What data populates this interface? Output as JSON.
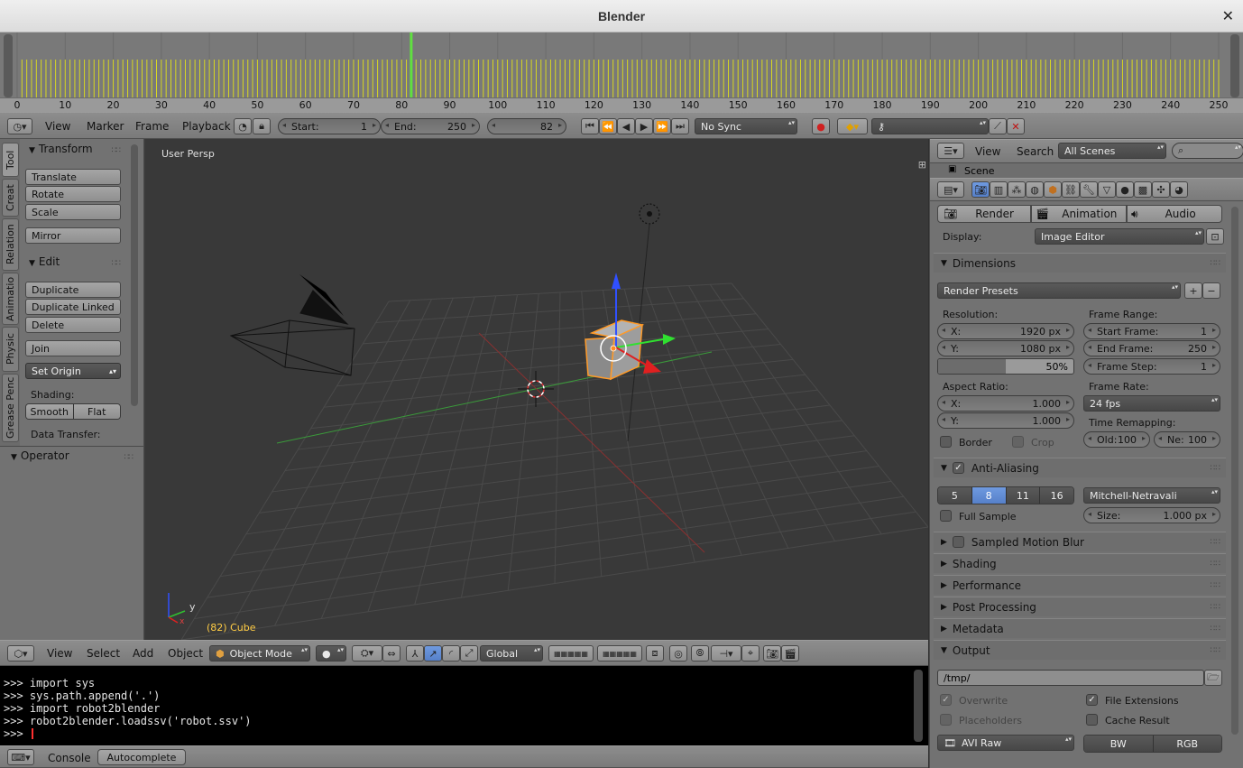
{
  "window": {
    "title": "Blender",
    "close_glyph": "✕"
  },
  "timeline": {
    "ruler_labels": [
      "0",
      "10",
      "20",
      "30",
      "40",
      "50",
      "60",
      "70",
      "80",
      "90",
      "100",
      "110",
      "120",
      "130",
      "140",
      "150",
      "160",
      "170",
      "180",
      "190",
      "200",
      "210",
      "220",
      "230",
      "240",
      "250"
    ],
    "current_frame_marker": 82,
    "keyframe_color": "#d8d820",
    "current_color": "#60e040"
  },
  "timeline_header": {
    "menus": [
      "View",
      "Marker",
      "Frame",
      "Playback"
    ],
    "start_label": "Start:",
    "start_value": "1",
    "end_label": "End:",
    "end_value": "250",
    "current_value": "82",
    "sync": "No Sync"
  },
  "toolshelf": {
    "tabs": [
      "Tool",
      "Creat",
      "Relation",
      "Animatio",
      "Physic",
      "Grease Penc"
    ],
    "transform": {
      "title": "Transform",
      "buttons": [
        "Translate",
        "Rotate",
        "Scale",
        "Mirror"
      ]
    },
    "edit": {
      "title": "Edit",
      "buttons": [
        "Duplicate",
        "Duplicate Linked",
        "Delete",
        "Join"
      ],
      "set_origin": "Set Origin"
    },
    "shading_label": "Shading:",
    "smooth": "Smooth",
    "flat": "Flat",
    "data_transfer_label": "Data Transfer:",
    "operator_title": "Operator"
  },
  "viewport": {
    "title": "User Persp",
    "object_label": "(82) Cube",
    "axis_y": "y",
    "axis_x": "x"
  },
  "view3d_header": {
    "menus": [
      "View",
      "Select",
      "Add",
      "Object"
    ],
    "mode": "Object Mode",
    "orientation": "Global"
  },
  "console": {
    "lines": [
      ">>> import sys",
      ">>> sys.path.append('.')",
      ">>> import robot2blender",
      ">>> robot2blender.loadssv('robot.ssv')",
      ">>> "
    ],
    "tabs": [
      "Console",
      "Autocomplete"
    ]
  },
  "outliner_header": {
    "menus": [
      "View",
      "Search"
    ],
    "scenes": "All Scenes",
    "scene_item": "Scene"
  },
  "properties": {
    "tabs": [
      "Render",
      "Animation",
      "Audio"
    ],
    "display_label": "Display:",
    "display_value": "Image Editor",
    "dimensions": {
      "title": "Dimensions",
      "presets": "Render Presets",
      "resolution_label": "Resolution:",
      "res_x_label": "X:",
      "res_x": "1920 px",
      "res_y_label": "Y:",
      "res_y": "1080 px",
      "res_pct": "50%",
      "frame_range_label": "Frame Range:",
      "start_frame_label": "Start Frame:",
      "start_frame": "1",
      "end_frame_label": "End Frame:",
      "end_frame": "250",
      "frame_step_label": "Frame Step:",
      "frame_step": "1",
      "aspect_label": "Aspect Ratio:",
      "asp_x_label": "X:",
      "asp_x": "1.000",
      "asp_y_label": "Y:",
      "asp_y": "1.000",
      "frame_rate_label": "Frame Rate:",
      "frame_rate": "24 fps",
      "time_remap_label": "Time Remapping:",
      "old_label": "Old:",
      "old_value": "100",
      "new_label": "Ne:",
      "new_value": "100",
      "border": "Border",
      "crop": "Crop"
    },
    "aa": {
      "title": "Anti-Aliasing",
      "samples": [
        "5",
        "8",
        "11",
        "16"
      ],
      "selected": "8",
      "filter": "Mitchell-Netravali",
      "full_sample": "Full Sample",
      "size_label": "Size:",
      "size_value": "1.000 px"
    },
    "collapsed_sections": [
      "Sampled Motion Blur",
      "Shading",
      "Performance",
      "Post Processing",
      "Metadata"
    ],
    "output": {
      "title": "Output",
      "path": "/tmp/",
      "overwrite": "Overwrite",
      "file_extensions": "File Extensions",
      "placeholders": "Placeholders",
      "cache_result": "Cache Result",
      "format": "AVI Raw",
      "bw": "BW",
      "rgb": "RGB"
    }
  }
}
